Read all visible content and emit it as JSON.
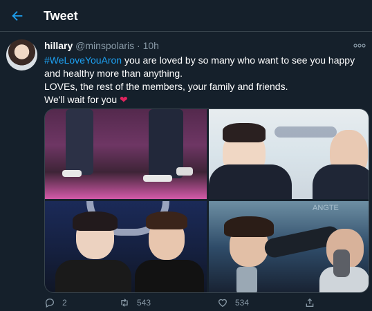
{
  "header": {
    "title": "Tweet"
  },
  "tweet": {
    "name": "hillary",
    "handle": "@minspolaris",
    "separator": "·",
    "time": "10h",
    "hashtag": "#WeLoveYouAron",
    "line1_rest": " you are loved by so many who want to see you happy and healthy more than anything.",
    "line2": "LOVEs, the rest of the members, your family and friends.",
    "line3": "We'll wait for you",
    "heart": "❤"
  },
  "media": {
    "photo4_overlay": "ANGTE"
  },
  "actions": {
    "replies": "2",
    "retweets": "543",
    "likes": "534"
  },
  "colors": {
    "background": "#15202b",
    "accent": "#1da1f2",
    "muted": "#8899a6",
    "heart": "#e0245e"
  }
}
